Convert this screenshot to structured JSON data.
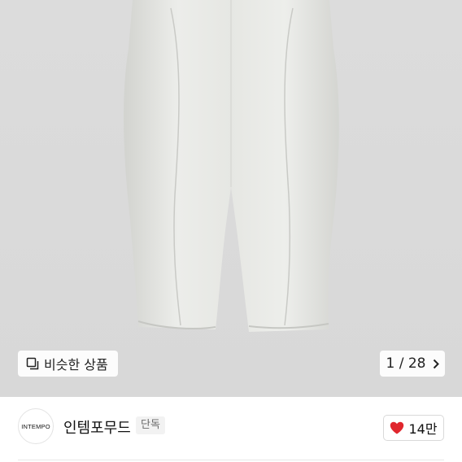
{
  "gallery": {
    "similar_label": "비슷한 상품",
    "similar_icon": "duplicate-icon",
    "pager_current": "1",
    "pager_separator": "/",
    "pager_total": "28",
    "next_icon": "chevron-right-icon"
  },
  "seller": {
    "logo_text": "INTEMPO",
    "name": "인템포무드",
    "badge": "단독"
  },
  "like": {
    "icon": "heart-icon",
    "count": "14만",
    "color": "#e0262d"
  }
}
